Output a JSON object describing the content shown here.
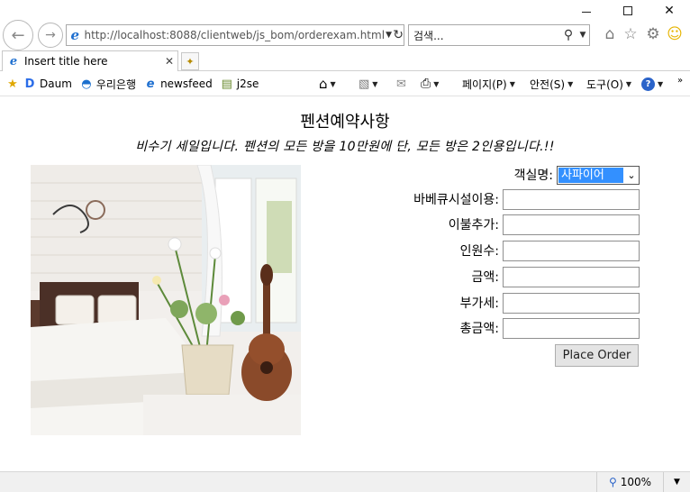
{
  "browser": {
    "url": "http://localhost:8088/clientweb/js_bom/orderexam.html",
    "search_placeholder": "검색...",
    "tab_title": "Insert title here",
    "favorites": [
      "Daum",
      "우리은행",
      "newsfeed",
      "j2se"
    ],
    "commands": {
      "page": "페이지(P)",
      "safety": "안전(S)",
      "tools": "도구(O)"
    },
    "zoom": "100%"
  },
  "page": {
    "title": "펜션예약사항",
    "subtitle": "비수기 세일입니다. 펜션의 모든 방을 10만원에 단, 모든 방은 2인용입니다.!!"
  },
  "form": {
    "room_label": "객실명:",
    "room_value": "사파이어",
    "bbq_label": "바베큐시설이용:",
    "blanket_label": "이불추가:",
    "people_label": "인원수:",
    "amount_label": "금액:",
    "vat_label": "부가세:",
    "total_label": "총금액:",
    "bbq_value": "",
    "blanket_value": "",
    "people_value": "",
    "amount_value": "",
    "vat_value": "",
    "total_value": "",
    "order_button": "Place Order"
  },
  "icons": {
    "back": "back-arrow-icon",
    "forward": "forward-arrow-icon",
    "home": "home-icon",
    "favorites": "star-icon",
    "settings": "gear-icon",
    "feedback": "smiley-icon"
  },
  "colors": {
    "select_highlight": "#3390ff",
    "ie_blue": "#1e6fd0"
  }
}
